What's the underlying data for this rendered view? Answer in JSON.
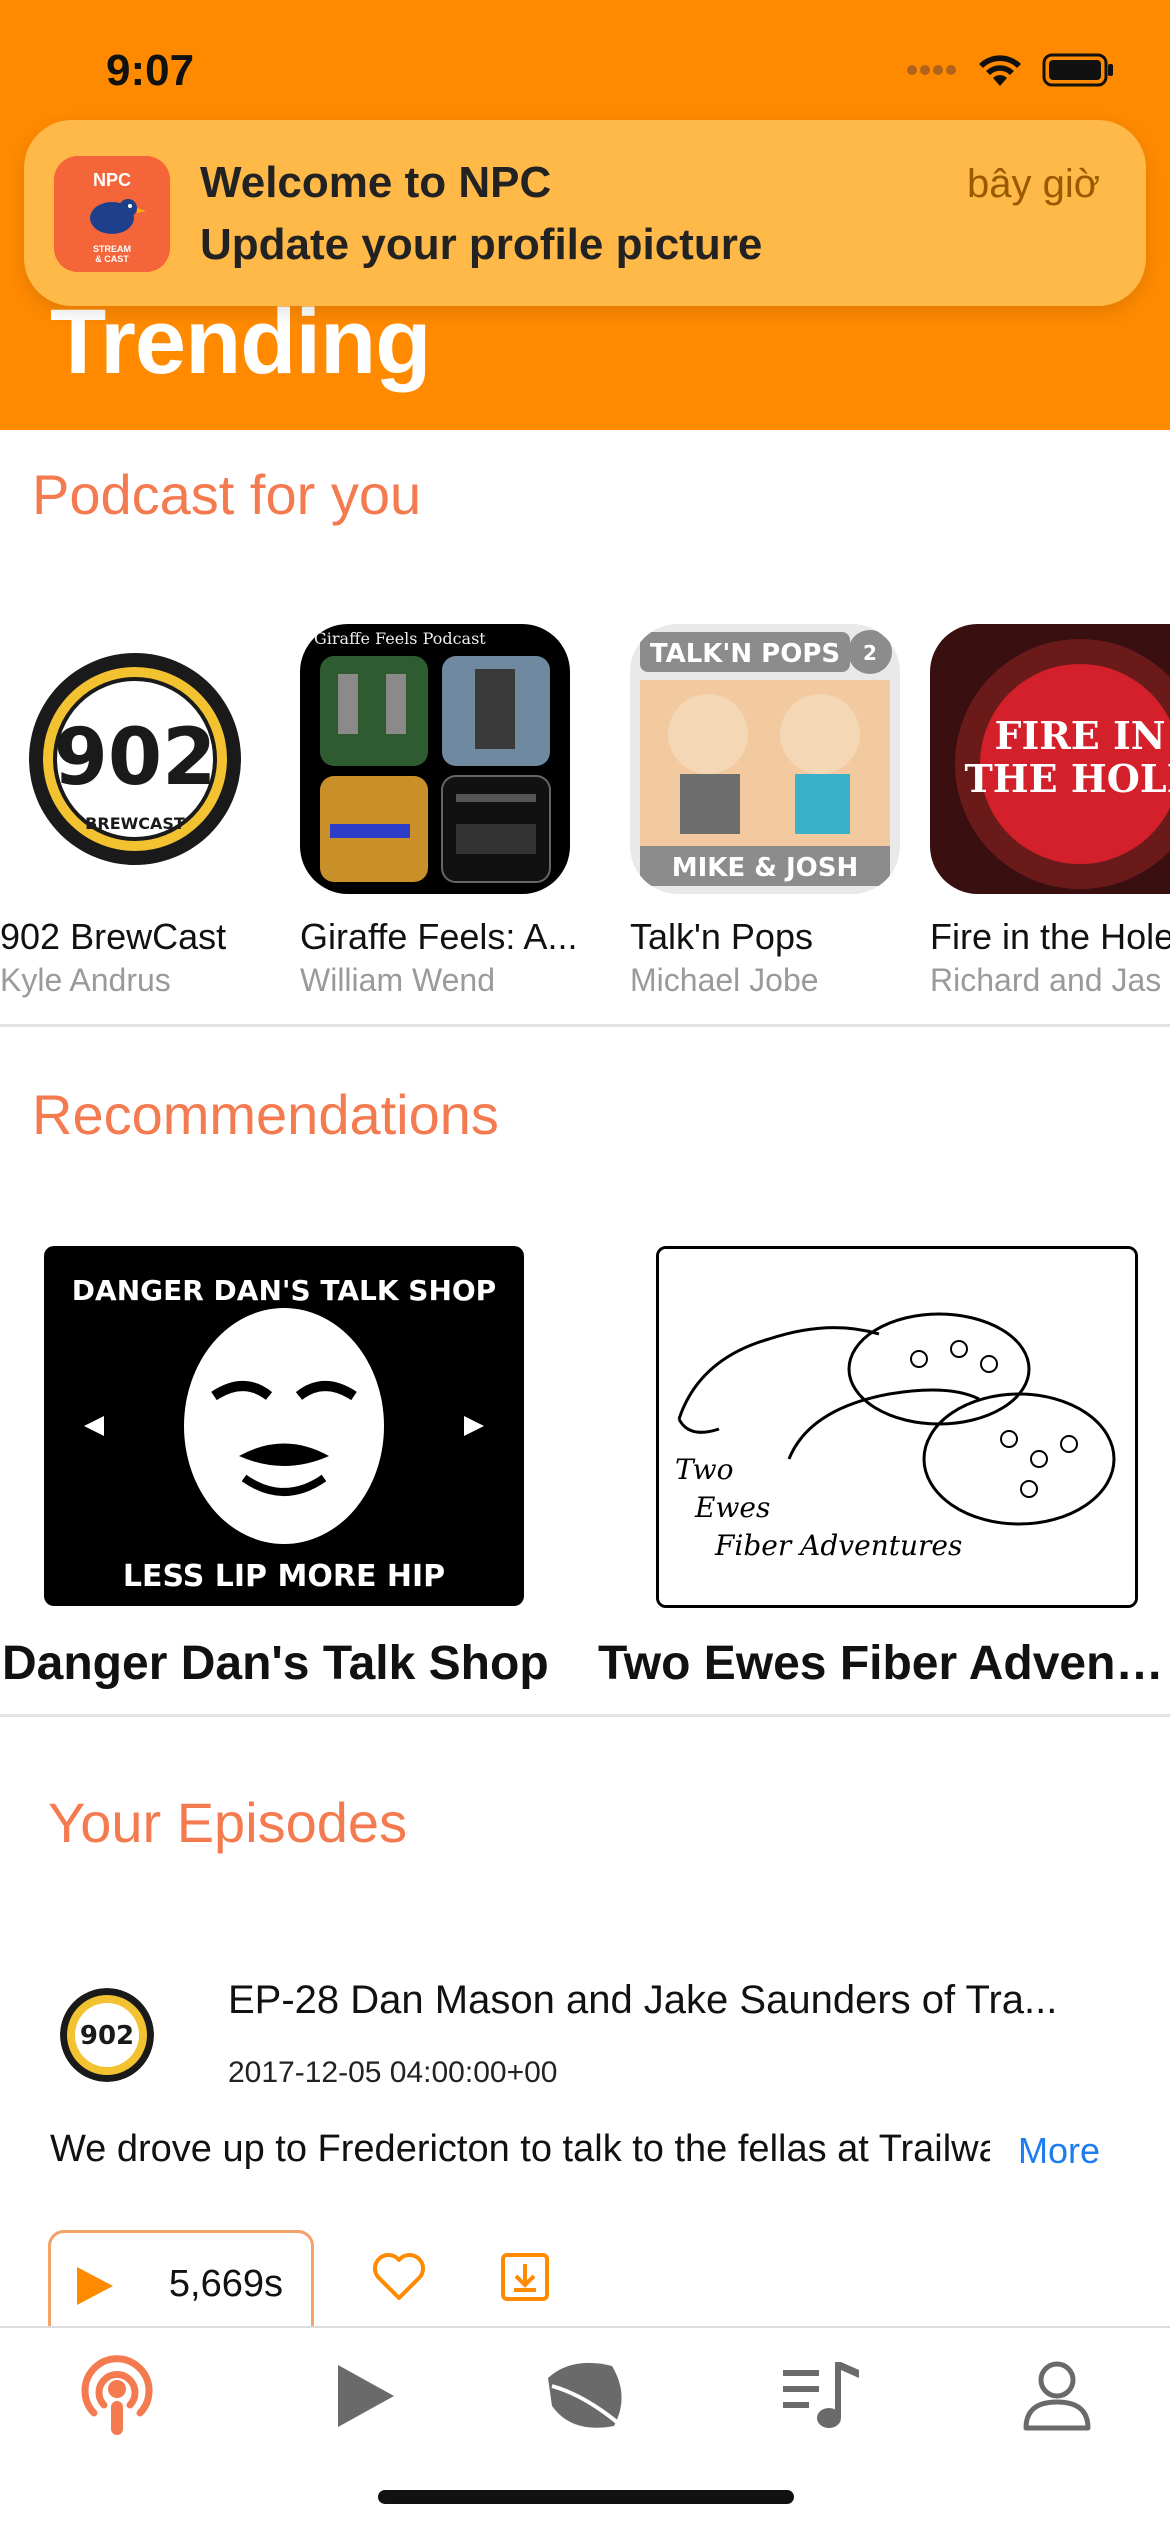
{
  "status_bar": {
    "time": "9:07"
  },
  "notification": {
    "title": "Welcome to NPC",
    "body": "Update your profile picture",
    "time": "bây giờ",
    "app_icon_text": "NPC STREAM & CAST"
  },
  "header": {
    "title": "Trending"
  },
  "podcast_for_you": {
    "title": "Podcast for you",
    "items": [
      {
        "title": "902 BrewCast",
        "author": "Kyle Andrus",
        "art_text": "902 BREWCAST"
      },
      {
        "title": "Giraffe Feels: A...",
        "author": "William Wend",
        "art_text": "Giraffe Feels Podcast"
      },
      {
        "title": "Talk'n Pops",
        "author": "Michael Jobe",
        "art_text_top": "TALK'N POPS",
        "art_text_bottom": "MIKE & JOSH"
      },
      {
        "title": "Fire in the Hole",
        "author": "Richard and Jas",
        "art_text": "FIRE IN THE HOLE"
      }
    ]
  },
  "recommendations": {
    "title": "Recommendations",
    "items": [
      {
        "title": "Danger Dan's Talk Shop",
        "art_text_top": "DANGER DAN'S TALK SHOP",
        "art_text_bottom": "LESS LIP MORE HIP"
      },
      {
        "title": "Two Ewes Fiber Advent...",
        "art_text": "Two Ewes Fiber Adventures"
      }
    ]
  },
  "your_episodes": {
    "title": "Your Episodes",
    "episode": {
      "title": "EP-28 Dan Mason and Jake Saunders of Tra...",
      "date": "2017-12-05 04:00:00+00",
      "description": "We drove up to Fredericton to talk to the fellas at Trailway",
      "more_label": "More",
      "duration": "5,669s"
    }
  },
  "tabs": [
    "podcasts",
    "play",
    "discover",
    "playlist",
    "profile"
  ],
  "colors": {
    "accent": "#FF8A00",
    "section_title": "#F47A50",
    "link": "#1E7CF2",
    "notification_bg": "#FFB948"
  }
}
